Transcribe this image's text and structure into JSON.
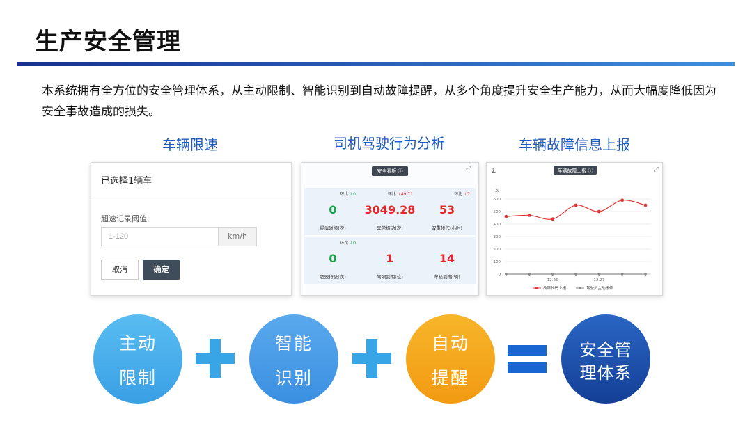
{
  "slide": {
    "title": "生产安全管理",
    "intro": "本系统拥有全方位的安全管理体系，从主动限制、智能识别到自动故障提醒，从多个角度提升安全生产能力，从而大幅度降低因为安全事故造成的损失。"
  },
  "sections": {
    "speed_limit": "车辆限速",
    "driver_behavior": "司机驾驶行为分析",
    "fault_report": "车辆故障信息上报"
  },
  "speed_panel": {
    "heading": "已选择1辆车",
    "threshold_label": "超速记录阈值:",
    "input_placeholder": "1-120",
    "unit": "km/h",
    "cancel_label": "取消",
    "confirm_label": "确定"
  },
  "dashboard": {
    "tag": "安全看板",
    "cells": [
      {
        "compare": "环比",
        "arrow": "↓",
        "change": "0",
        "trend": "down",
        "value": "0",
        "value_color": "#19a14a",
        "caption": "疑似碰撞(次)"
      },
      {
        "compare": "环比",
        "arrow": "↑",
        "change": "49.71",
        "trend": "up",
        "value": "3049.28",
        "value_color": "#e5262b",
        "caption": "异常振动(次)"
      },
      {
        "compare": "环比",
        "arrow": "↑",
        "change": "7",
        "trend": "up",
        "value": "53",
        "value_color": "#e5262b",
        "caption": "双重操作(小时)"
      },
      {
        "compare": "环比",
        "arrow": "↓",
        "change": "0",
        "trend": "down",
        "value": "0",
        "value_color": "#19a14a",
        "caption": "超速行驶(次)"
      },
      {
        "compare": "",
        "arrow": "",
        "change": "",
        "trend": "",
        "value": "1",
        "value_color": "#e5262b",
        "caption": "驾照到期(位)"
      },
      {
        "compare": "",
        "arrow": "",
        "change": "",
        "trend": "",
        "value": "14",
        "value_color": "#e5262b",
        "caption": "年检到期(辆)"
      }
    ]
  },
  "fault_chart": {
    "tag": "车辆故障上报",
    "sigma": "Σ",
    "y_unit": "次"
  },
  "chart_data": {
    "type": "line",
    "title": "车辆故障上报",
    "ylabel": "次",
    "ylim": [
      0,
      600
    ],
    "yticks": [
      0,
      100,
      200,
      300,
      400,
      500,
      600
    ],
    "x": [
      1,
      2,
      3,
      4,
      5,
      6,
      7
    ],
    "xtick_labels": [
      {
        "at": 3,
        "label": "12.25"
      },
      {
        "at": 5,
        "label": "12.27"
      }
    ],
    "series": [
      {
        "name": "故障代码上报",
        "color": "#e03535",
        "values": [
          460,
          470,
          440,
          550,
          500,
          590,
          550
        ]
      },
      {
        "name": "驾驶员主动报修",
        "color": "#8a8a8a",
        "values": [
          0,
          0,
          0,
          0,
          0,
          0,
          0
        ]
      }
    ],
    "grid": true,
    "legend": "bottom",
    "smooth": true
  },
  "formula": {
    "c1": {
      "line1": "主动",
      "line2": "限制"
    },
    "c2": {
      "line1": "智能",
      "line2": "识别"
    },
    "c3": {
      "line1": "自动",
      "line2": "提醒"
    },
    "c4": {
      "line1": "安全管",
      "line2": "理体系"
    }
  },
  "colors": {
    "accent_blue": "#1e5bc0",
    "circle1": "#4cb0ec",
    "circle2": "#4aa0e8",
    "circle3": "#f4a51c",
    "circle4": "#1b4fa8"
  }
}
